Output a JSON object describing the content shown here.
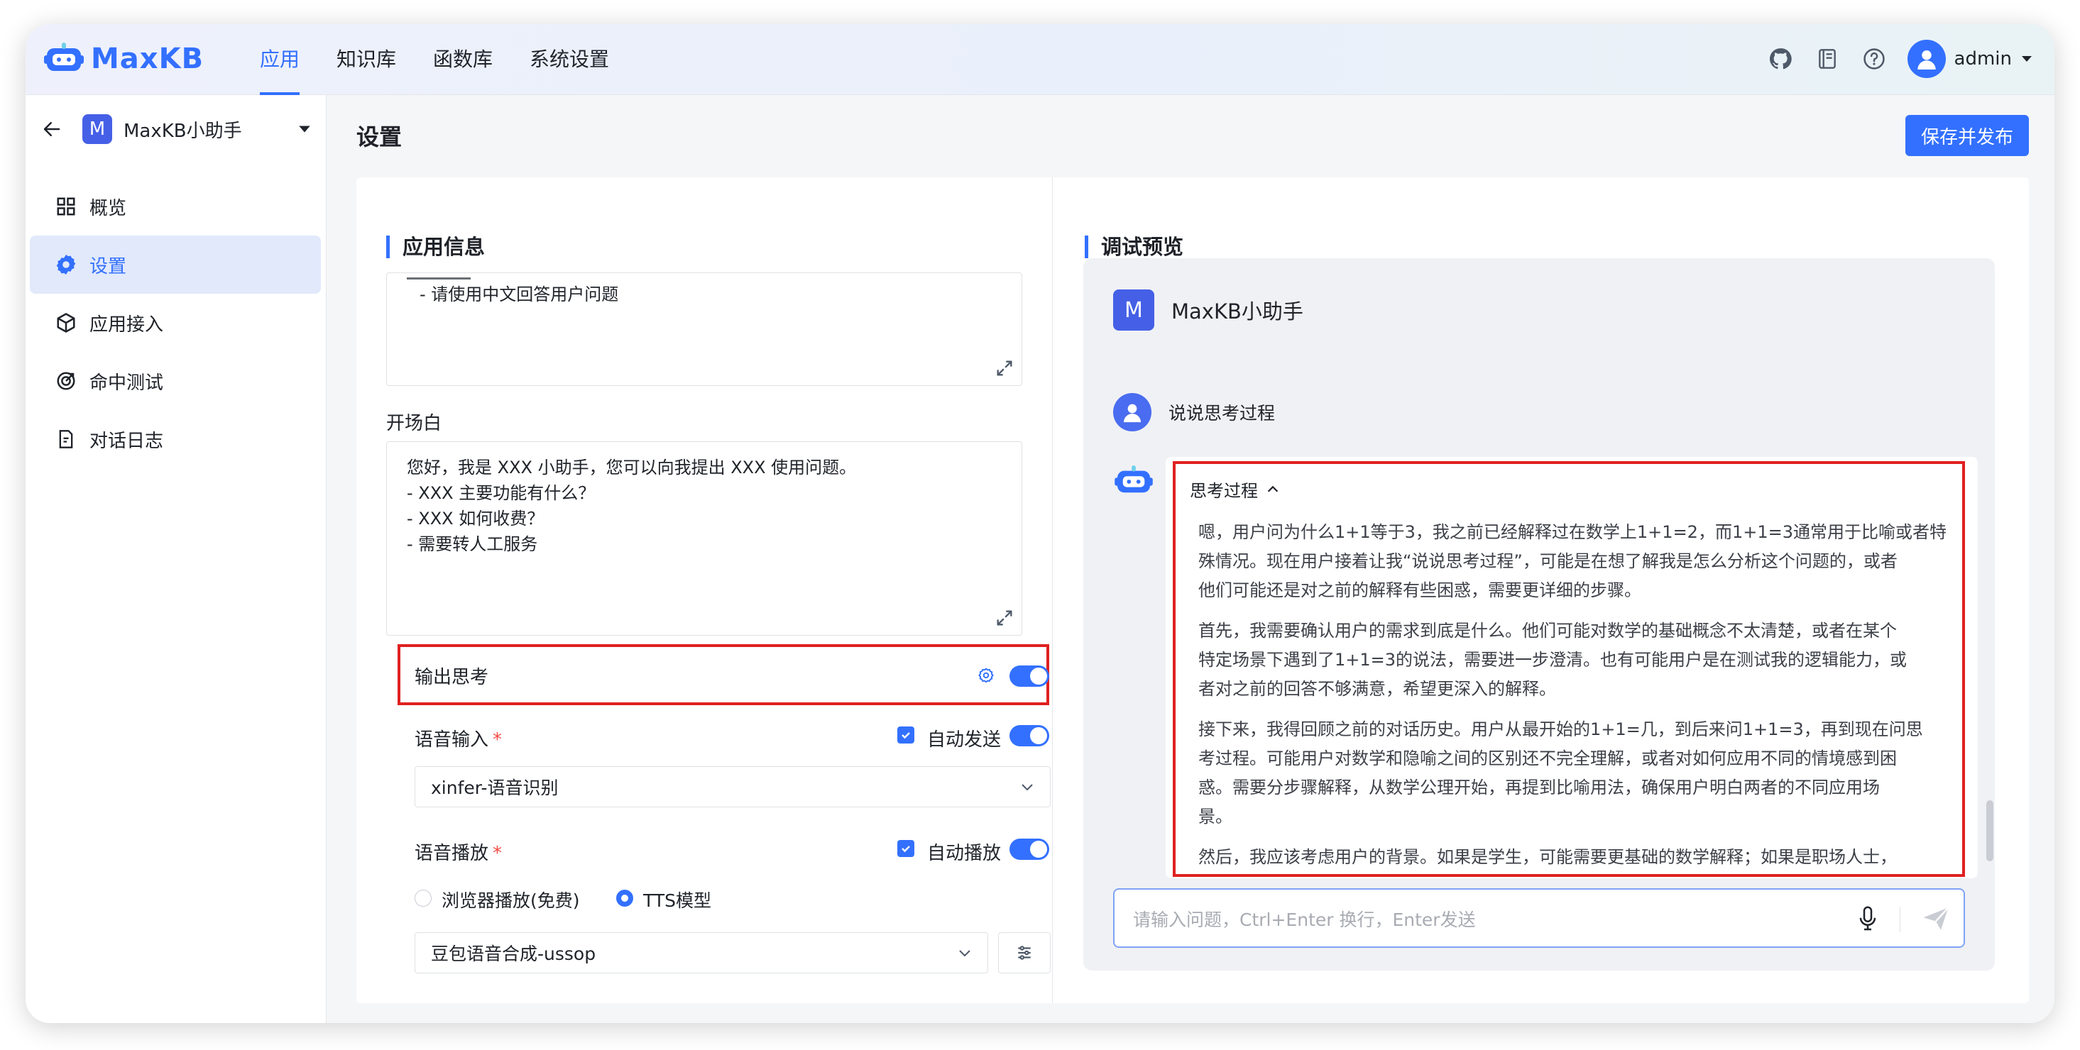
{
  "colors": {
    "accent": "#3370ff",
    "highlight_box": "#e02020",
    "badge": "#4560e6"
  },
  "topbar": {
    "logo_text": "MaxKB",
    "nav": [
      {
        "label": "应用",
        "active": true
      },
      {
        "label": "知识库"
      },
      {
        "label": "函数库"
      },
      {
        "label": "系统设置"
      }
    ],
    "icons": [
      "github-icon",
      "docs-book-icon",
      "help-icon"
    ],
    "user_name": "admin"
  },
  "sidebar": {
    "app_badge": "M",
    "app_name": "MaxKB小助手",
    "items": [
      {
        "label": "概览",
        "icon": "overview-grid-icon"
      },
      {
        "label": "设置",
        "icon": "gear-icon",
        "active": true
      },
      {
        "label": "应用接入",
        "icon": "app-access-icon"
      },
      {
        "label": "命中测试",
        "icon": "hit-test-icon"
      },
      {
        "label": "对话日志",
        "icon": "chat-log-icon"
      }
    ]
  },
  "page": {
    "title": "设置",
    "save_button": "保存并发布"
  },
  "app_info": {
    "section_title": "应用信息",
    "prompt_truncated": "- 请使用中文回答用户问题",
    "opening_label": "开场白",
    "opening_lines": [
      "您好，我是 XXX 小助手，您可以向我提出 XXX 使用问题。",
      "- XXX 主要功能有什么？",
      "- XXX 如何收费？",
      "- 需要转人工服务"
    ],
    "output_thinking": {
      "label": "输出思考",
      "enabled": true
    },
    "voice_input": {
      "label": "语音输入",
      "required_mark": "*",
      "auto_send_label": "自动发送",
      "auto_send_checked": true,
      "enabled": true,
      "selected": "xinfer-语音识别"
    },
    "voice_playback": {
      "label": "语音播放",
      "required_mark": "*",
      "auto_play_label": "自动播放",
      "auto_play_checked": true,
      "enabled": true,
      "options": [
        "浏览器播放(免费)",
        "TTS模型"
      ],
      "selected_option": "TTS模型",
      "selected_model": "豆包语音合成-ussop"
    }
  },
  "preview": {
    "section_title": "调试预览",
    "bot_badge": "M",
    "bot_name": "MaxKB小助手",
    "user_question": "说说思考过程",
    "thinking_label": "思考过程",
    "thinking_lines": [
      "嗯，用户问为什么1+1等于3，我之前已经解释过在数学上1+1=2，而1+1=3通常用于比喻或者特",
      "殊情况。现在用户接着让我“说说思考过程”，可能是在想了解我是怎么分析这个问题的，或者",
      "他们可能还是对之前的解释有些困惑，需要更详细的步骤。",
      "首先，我需要确认用户的需求到底是什么。他们可能对数学的基础概念不太清楚，或者在某个",
      "特定场景下遇到了1+1=3的说法，需要进一步澄清。也有可能用户是在测试我的逻辑能力，或",
      "者对之前的回答不够满意，希望更深入的解释。",
      "接下来，我得回顾之前的对话历史。用户从最开始的1+1=几，到后来问1+1=3，再到现在问思",
      "考过程。可能用户对数学和隐喻之间的区别还不完全理解，或者对如何应用不同的情境感到困",
      "惑。需要分步骤解释，从数学公理开始，再提到比喻用法，确保用户明白两者的不同应用场",
      "景。",
      "然后，我应该考虑用户的背景。如果是学生，可能需要更基础的数学解释；如果是职场人士，"
    ],
    "input_placeholder": "请输入问题，Ctrl+Enter 换行，Enter发送"
  }
}
